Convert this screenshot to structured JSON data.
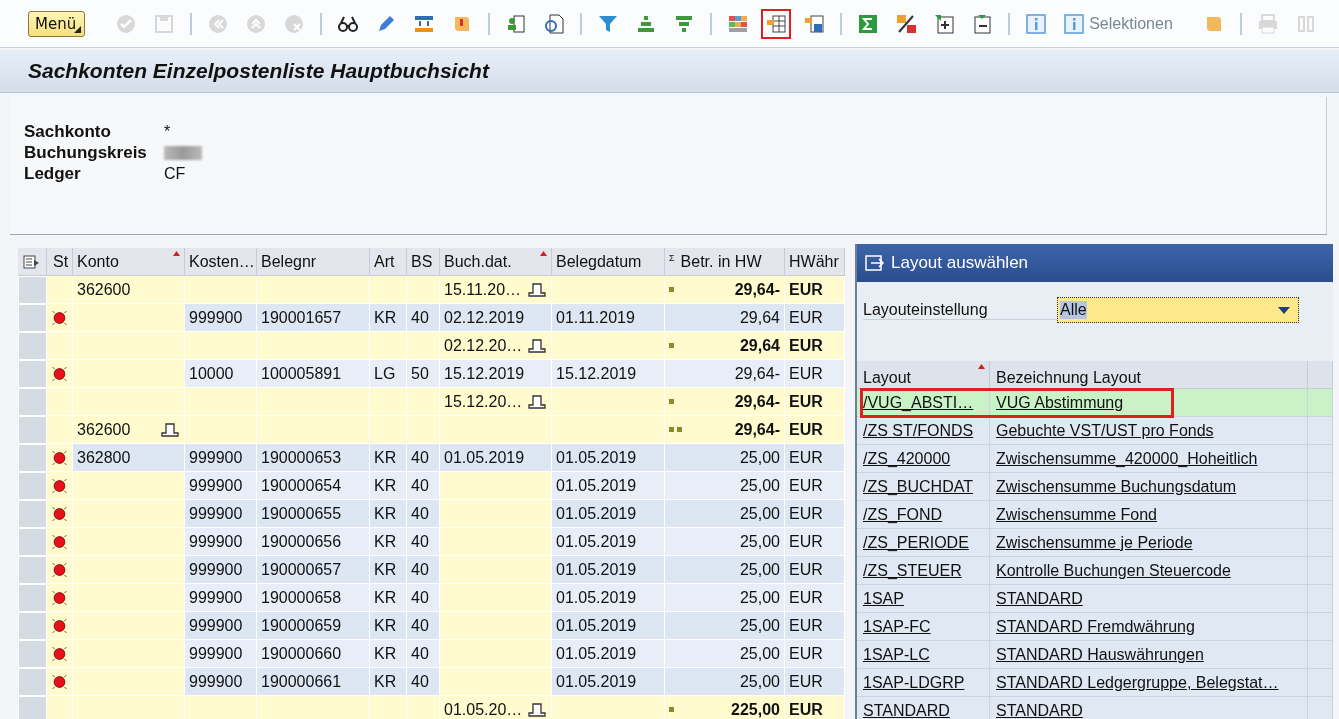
{
  "toolbar": {
    "menu_button": "Menü",
    "groups": [
      [
        {
          "disabled": true,
          "highlighted": false
        },
        {
          "disabled": true,
          "highlighted": false
        }
      ],
      [
        {
          "disabled": true,
          "highlighted": false
        },
        {
          "disabled": true,
          "highlighted": false
        },
        {
          "disabled": true,
          "highlighted": false
        }
      ],
      [
        {
          "disabled": false,
          "highlighted": false
        },
        {
          "disabled": false,
          "highlighted": false
        },
        {
          "disabled": false,
          "highlighted": false
        },
        {
          "disabled": false,
          "highlighted": false
        }
      ],
      [
        {
          "disabled": false,
          "highlighted": false
        },
        {
          "disabled": false,
          "highlighted": false
        }
      ],
      [
        {
          "disabled": false,
          "highlighted": false
        },
        {
          "disabled": false,
          "highlighted": false
        },
        {
          "disabled": false,
          "highlighted": false
        }
      ],
      [
        {
          "disabled": false,
          "highlighted": false
        },
        {
          "disabled": false,
          "highlighted": true
        },
        {
          "disabled": false,
          "highlighted": false
        }
      ],
      [
        {
          "disabled": false,
          "highlighted": false
        },
        {
          "disabled": false,
          "highlighted": false
        },
        {
          "disabled": false,
          "highlighted": false
        },
        {
          "disabled": false,
          "highlighted": false
        }
      ],
      [
        {
          "disabled": false,
          "highlighted": false
        },
        {
          "disabled": false,
          "highlighted": false,
          "label": "Selektionen"
        },
        {
          "disabled": false,
          "highlighted": false
        }
      ],
      [
        {
          "disabled": true,
          "highlighted": false
        },
        {
          "disabled": true,
          "highlighted": false
        }
      ]
    ]
  },
  "window": {
    "title": "Sachkonten Einzelpostenliste Hauptbuchsicht"
  },
  "header_fields": [
    {
      "kind": "text",
      "label": "Sachkonto",
      "value": "*"
    },
    {
      "kind": "blurred",
      "label": "Buchungskreis"
    },
    {
      "kind": "text",
      "label": "Ledger",
      "value": "CF"
    }
  ],
  "table": {
    "sum_symbol": "Σ",
    "columns": [
      "St",
      "Konto",
      "Kosten…",
      "Belegnr",
      "Art",
      "BS",
      "Buch.dat.",
      "Belegdatum",
      "Betr. in HW",
      "HWähr"
    ],
    "rows": [
      {
        "kind": "subtotal",
        "konto": "362600",
        "buchdat": "15.11.20…",
        "betrag": "29,64-",
        "waehrung": "EUR"
      },
      {
        "kind": "item",
        "kosten": "999900",
        "belegnr": "190001657",
        "art": "KR",
        "bs": "40",
        "buchdat": "02.12.2019",
        "belegdatum": "01.11.2019",
        "betrag": "29,64",
        "waehrung": "EUR"
      },
      {
        "kind": "subtotal",
        "buchdat": "02.12.20…",
        "betrag": "29,64",
        "waehrung": "EUR"
      },
      {
        "kind": "item",
        "kosten": "10000",
        "belegnr": "100005891",
        "art": "LG",
        "bs": "50",
        "buchdat": "15.12.2019",
        "belegdatum": "15.12.2019",
        "betrag": "29,64-",
        "waehrung": "EUR"
      },
      {
        "kind": "subtotal",
        "buchdat": "15.12.20…",
        "betrag": "29,64-",
        "waehrung": "EUR"
      },
      {
        "kind": "total",
        "konto": "362600",
        "betrag": "29,64-",
        "waehrung": "EUR"
      },
      {
        "kind": "item",
        "konto": "362800",
        "kosten": "999900",
        "belegnr": "190000653",
        "art": "KR",
        "bs": "40",
        "buchdat": "01.05.2019",
        "belegdatum": "01.05.2019",
        "betrag": "25,00",
        "waehrung": "EUR"
      },
      {
        "kind": "item",
        "kosten": "999900",
        "belegnr": "190000654",
        "art": "KR",
        "bs": "40",
        "belegdatum": "01.05.2019",
        "betrag": "25,00",
        "waehrung": "EUR"
      },
      {
        "kind": "item",
        "kosten": "999900",
        "belegnr": "190000655",
        "art": "KR",
        "bs": "40",
        "belegdatum": "01.05.2019",
        "betrag": "25,00",
        "waehrung": "EUR"
      },
      {
        "kind": "item",
        "kosten": "999900",
        "belegnr": "190000656",
        "art": "KR",
        "bs": "40",
        "belegdatum": "01.05.2019",
        "betrag": "25,00",
        "waehrung": "EUR"
      },
      {
        "kind": "item",
        "kosten": "999900",
        "belegnr": "190000657",
        "art": "KR",
        "bs": "40",
        "belegdatum": "01.05.2019",
        "betrag": "25,00",
        "waehrung": "EUR"
      },
      {
        "kind": "item",
        "kosten": "999900",
        "belegnr": "190000658",
        "art": "KR",
        "bs": "40",
        "belegdatum": "01.05.2019",
        "betrag": "25,00",
        "waehrung": "EUR"
      },
      {
        "kind": "item",
        "kosten": "999900",
        "belegnr": "190000659",
        "art": "KR",
        "bs": "40",
        "belegdatum": "01.05.2019",
        "betrag": "25,00",
        "waehrung": "EUR"
      },
      {
        "kind": "item",
        "kosten": "999900",
        "belegnr": "190000660",
        "art": "KR",
        "bs": "40",
        "belegdatum": "01.05.2019",
        "betrag": "25,00",
        "waehrung": "EUR"
      },
      {
        "kind": "item",
        "kosten": "999900",
        "belegnr": "190000661",
        "art": "KR",
        "bs": "40",
        "belegdatum": "01.05.2019",
        "betrag": "25,00",
        "waehrung": "EUR"
      },
      {
        "kind": "subtotal",
        "buchdat": "01.05.20…",
        "betrag": "225,00",
        "waehrung": "EUR"
      }
    ]
  },
  "dialog": {
    "title": "Layout auswählen",
    "setting_label": "Layouteinstellung",
    "setting_value": "Alle",
    "columns": [
      "Layout",
      "Bezeichnung Layout"
    ],
    "rows": [
      {
        "layout": "/VUG_ABSTI…",
        "name": "VUG Abstimmung",
        "selected": true,
        "highlighted": true
      },
      {
        "layout": "/ZS ST/FONDS",
        "name": "Gebuchte VST/UST pro Fonds",
        "selected": false,
        "highlighted": false
      },
      {
        "layout": "/ZS_420000",
        "name": "Zwischensumme_420000_Hoheitlich",
        "selected": false,
        "highlighted": false
      },
      {
        "layout": "/ZS_BUCHDAT",
        "name": "Zwischensumme Buchungsdatum",
        "selected": false,
        "highlighted": false
      },
      {
        "layout": "/ZS_FOND",
        "name": "Zwischensumme Fond",
        "selected": false,
        "highlighted": false
      },
      {
        "layout": "/ZS_PERIODE",
        "name": "Zwischensumme je Periode",
        "selected": false,
        "highlighted": false
      },
      {
        "layout": "/ZS_STEUER",
        "name": "Kontrolle Buchungen Steuercode",
        "selected": false,
        "highlighted": false
      },
      {
        "layout": "1SAP",
        "name": "STANDARD",
        "selected": false,
        "highlighted": false
      },
      {
        "layout": "1SAP-FC",
        "name": "STANDARD Fremdwährung",
        "selected": false,
        "highlighted": false
      },
      {
        "layout": "1SAP-LC",
        "name": "STANDARD Hauswährungen",
        "selected": false,
        "highlighted": false
      },
      {
        "layout": "1SAP-LDGRP",
        "name": "STANDARD Ledgergruppe, Belegstat…",
        "selected": false,
        "highlighted": false
      },
      {
        "layout": "STANDARD",
        "name": "STANDARD",
        "selected": false,
        "highlighted": false
      }
    ]
  }
}
